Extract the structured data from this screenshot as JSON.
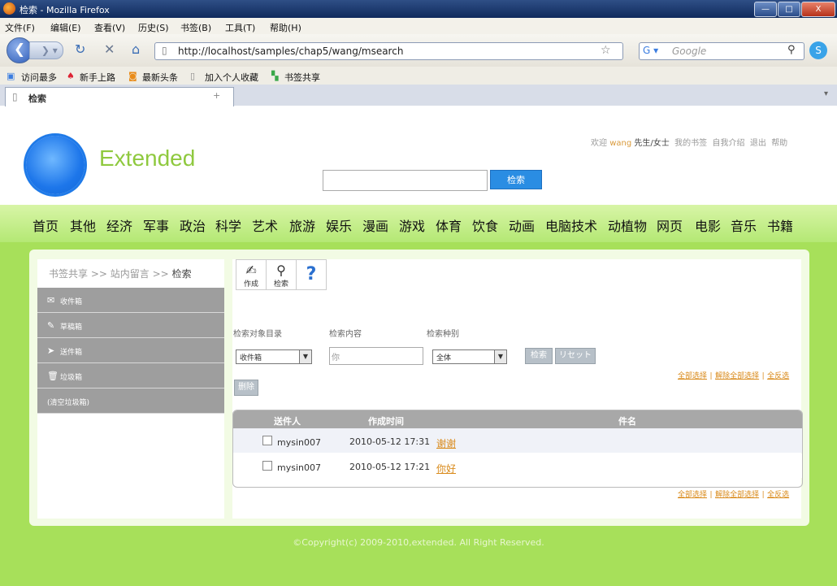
{
  "window": {
    "title": "检索 - Mozilla Firefox",
    "minimize": "—",
    "maximize": "□",
    "close": "X"
  },
  "menu": [
    "文件(F)",
    "编辑(E)",
    "查看(V)",
    "历史(S)",
    "书签(B)",
    "工具(T)",
    "帮助(H)"
  ],
  "nav": {
    "url": "http://localhost/samples/chap5/wang/msearch",
    "search_placeholder": "Google"
  },
  "bookmarks": [
    "访问最多",
    "新手上路",
    "最新头条",
    "加入个人收藏",
    "书签共享"
  ],
  "tab": {
    "title": "检索",
    "new_tab": "+"
  },
  "site": {
    "logo": "Extended",
    "user": {
      "welcome": "欢迎",
      "name": "wang",
      "honorific": "先生/女士",
      "links": [
        "我的书签",
        "自我介绍",
        "退出",
        "帮助"
      ]
    },
    "search_button": "检索",
    "categories": [
      "首页",
      "其他",
      "经济",
      "军事",
      "政治",
      "科学",
      "艺术",
      "旅游",
      "娱乐",
      "漫画",
      "游戏",
      "体育",
      "饮食",
      "动画",
      "电脑技术",
      "动植物",
      "网页",
      "电影",
      "音乐",
      "书籍"
    ]
  },
  "breadcrumb": {
    "a": "书签共享",
    "b": "站内留言",
    "c": "检索",
    "sep": ">>"
  },
  "sidebar": [
    {
      "label": "收件箱",
      "icon": "inbox-icon"
    },
    {
      "label": "草稿箱",
      "icon": "draft-icon"
    },
    {
      "label": "送件箱",
      "icon": "sent-icon"
    },
    {
      "label": "垃圾箱",
      "icon": "trash-icon"
    },
    {
      "label": "(清空垃圾箱)"
    }
  ],
  "toolbar": {
    "compose": "作成",
    "search": "检索",
    "help": "?"
  },
  "form": {
    "target_label": "检索对象目录",
    "target_value": "收件箱",
    "content_label": "检索内容",
    "content_value": "你",
    "type_label": "检索种别",
    "type_value": "全体",
    "search_button": "检索",
    "reset_button": "リセット"
  },
  "select_links": {
    "all": "全部选择",
    "none": "解除全部选择",
    "invert": "全反选",
    "sep": "|"
  },
  "delete_button": "删除",
  "table": {
    "headers": [
      "送件人",
      "作成时间",
      "件名"
    ],
    "rows": [
      {
        "sender": "mysin007",
        "time": "2010-05-12 17:31",
        "subject": "谢谢"
      },
      {
        "sender": "mysin007",
        "time": "2010-05-12 17:21",
        "subject": "你好"
      }
    ]
  },
  "footer": "©Copyright(c) 2009-2010,extended. All Right Reserved."
}
